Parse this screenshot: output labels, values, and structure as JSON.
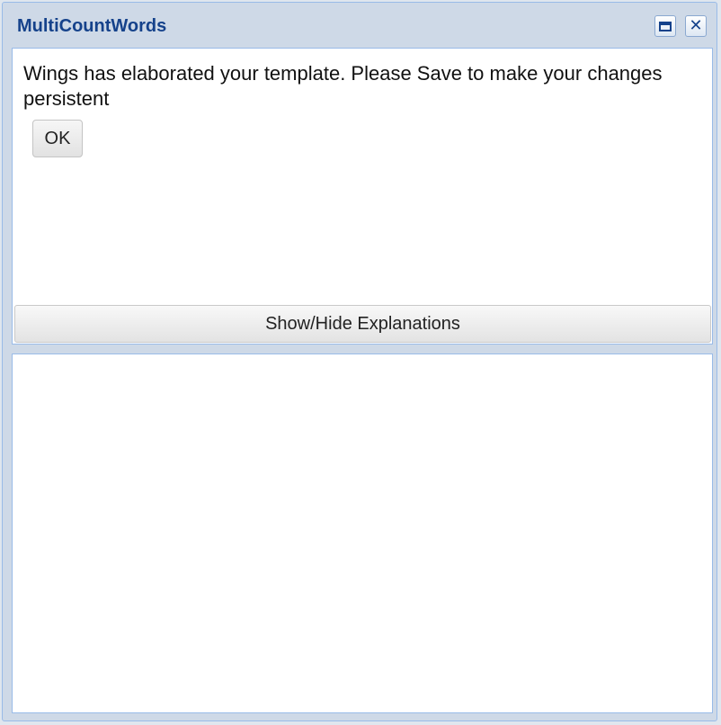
{
  "window": {
    "title": "MultiCountWords",
    "maximize_icon": "maximize-icon",
    "close_icon": "close-icon"
  },
  "dialog": {
    "message": "Wings has elaborated your template. Please Save to make your changes persistent",
    "ok_label": "OK"
  },
  "explanations": {
    "toggle_label": "Show/Hide Explanations"
  },
  "colors": {
    "title": "#15428b",
    "frame": "#ced9e7",
    "border": "#99bbe8"
  }
}
